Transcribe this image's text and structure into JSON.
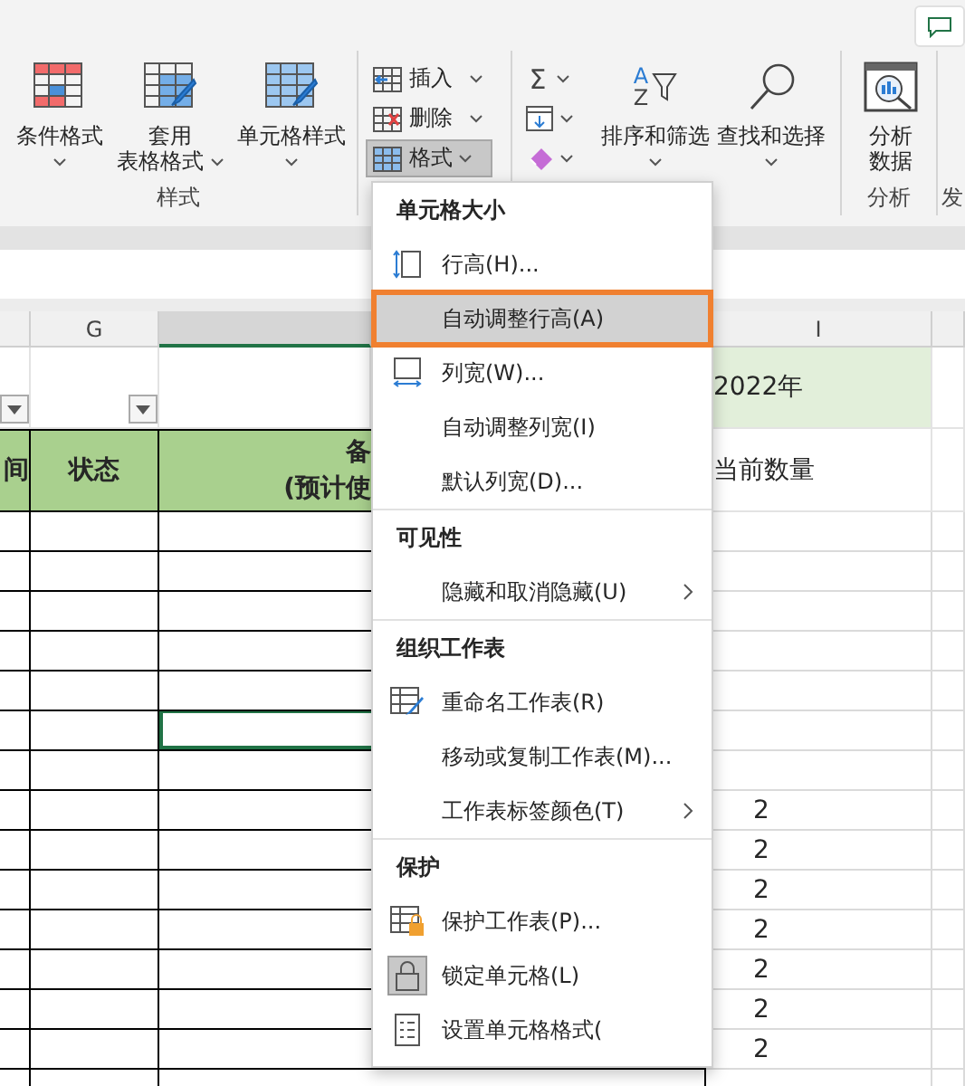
{
  "ribbon": {
    "styles_group": {
      "label": "样式",
      "buttons": [
        {
          "lines": [
            "条件格式"
          ]
        },
        {
          "lines": [
            "套用",
            "表格格式"
          ]
        },
        {
          "lines": [
            "单元格样式"
          ]
        }
      ]
    },
    "cells_group": {
      "buttons": [
        {
          "label": "插入",
          "selected": false
        },
        {
          "label": "删除",
          "selected": false
        },
        {
          "label": "格式",
          "selected": true
        }
      ]
    },
    "editing_group": {
      "autosum_symbol": "Σ",
      "sort_letters": [
        "A",
        "Z"
      ],
      "buttons": [
        {
          "label": "排序和筛选"
        },
        {
          "label": "查找和选择"
        }
      ]
    },
    "analysis_group": {
      "label": "分析",
      "button": {
        "lines": [
          "分析",
          "数据"
        ]
      }
    },
    "next_group": {
      "label": "发"
    }
  },
  "sheet": {
    "columns": [
      {
        "label": "G",
        "selected": false
      },
      {
        "selected": true
      },
      {
        "label": "I",
        "selected": false
      }
    ],
    "title_row": {
      "year": "2022年"
    },
    "header_row": {
      "cells": [
        "间",
        "状态"
      ],
      "remarks": [
        "备",
        "(预计使"
      ],
      "quantity": "当前数量"
    },
    "rows": [
      {
        "selected": false
      },
      {
        "selected": false
      },
      {
        "selected": false
      },
      {
        "selected": false
      },
      {
        "selected": false
      },
      {
        "selected": true
      },
      {
        "selected": false
      },
      {
        "selected": false,
        "quantity": "2"
      },
      {
        "selected": false,
        "quantity": "2"
      },
      {
        "selected": false,
        "quantity": "2"
      },
      {
        "selected": false,
        "quantity": "2"
      },
      {
        "selected": false,
        "quantity": "2"
      },
      {
        "selected": false,
        "quantity": "2"
      },
      {
        "selected": false,
        "quantity": "2"
      }
    ]
  },
  "format_menu": {
    "sections": [
      {
        "title": "单元格大小",
        "items": [
          {
            "label": "行高(H)...",
            "selected": false,
            "submenu": false
          },
          {
            "label": "自动调整行高(A)",
            "selected": true,
            "submenu": false
          },
          {
            "label": "列宽(W)...",
            "selected": false,
            "submenu": false
          },
          {
            "label": "自动调整列宽(I)",
            "selected": false,
            "submenu": false
          },
          {
            "label": "默认列宽(D)...",
            "selected": false,
            "submenu": false
          }
        ]
      },
      {
        "title": "可见性",
        "items": [
          {
            "label": "隐藏和取消隐藏(U)",
            "selected": false,
            "submenu": true
          }
        ]
      },
      {
        "title": "组织工作表",
        "items": [
          {
            "label": "重命名工作表(R)",
            "selected": false,
            "submenu": false
          },
          {
            "label": "移动或复制工作表(M)...",
            "selected": false,
            "submenu": false
          },
          {
            "label": "工作表标签颜色(T)",
            "selected": false,
            "submenu": true
          }
        ]
      },
      {
        "title": "保护",
        "items": [
          {
            "label": "保护工作表(P)...",
            "selected": false,
            "submenu": false
          },
          {
            "label": "锁定单元格(L)",
            "selected": false,
            "submenu": false
          },
          {
            "label": "设置单元格格式(",
            "selected": false,
            "submenu": false
          }
        ]
      }
    ]
  }
}
